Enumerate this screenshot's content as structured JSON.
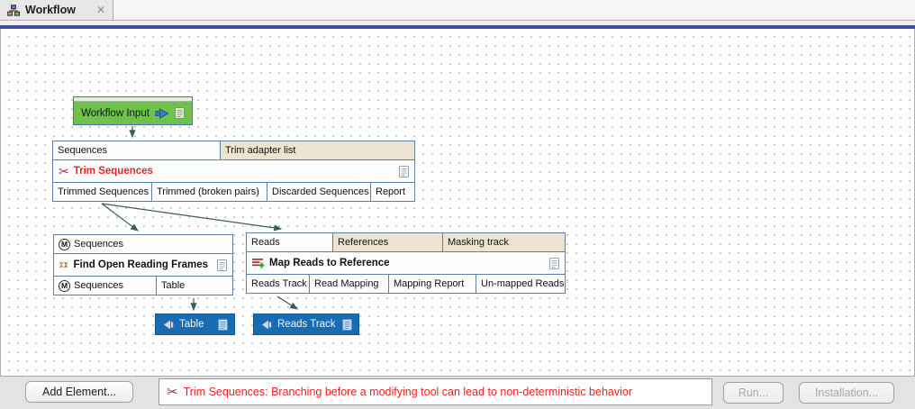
{
  "tab": {
    "title": "Workflow",
    "close_glyph": "✕"
  },
  "icons": {
    "m_badge": "M",
    "scissors": "✂"
  },
  "canvas": {
    "nodes": {
      "workflow_input": {
        "title": "Workflow Input"
      },
      "trim": {
        "title": "Trim Sequences",
        "inputs": [
          "Sequences",
          "Trim adapter list"
        ],
        "outputs": [
          "Trimmed Sequences",
          "Trimmed (broken pairs)",
          "Discarded Sequences",
          "Report"
        ]
      },
      "orf": {
        "title": "Find Open Reading Frames",
        "inputs": [
          "Sequences"
        ],
        "outputs": [
          "Sequences",
          "Table"
        ]
      },
      "map": {
        "title": "Map Reads to Reference",
        "inputs": [
          "Reads",
          "References",
          "Masking track"
        ],
        "outputs": [
          "Reads Track",
          "Read Mapping",
          "Mapping Report",
          "Un-mapped Reads"
        ]
      },
      "output_table": {
        "label": "Table"
      },
      "output_reads_track": {
        "label": "Reads Track"
      }
    }
  },
  "footer": {
    "add_element_label": "Add Element...",
    "status_message": "Trim Sequences: Branching before a modifying tool can lead to non-deterministic behavior",
    "run_label": "Run...",
    "installation_label": "Installation..."
  },
  "colors": {
    "accent_bar": "#3a52a0",
    "node_border": "#5f7fa7",
    "param_cell": "#ece4d1",
    "input_node_green": "#6fc14e",
    "output_node_blue": "#1a6cb2",
    "warning_red": "#ee2020",
    "arrow": "#3c5c5c"
  }
}
